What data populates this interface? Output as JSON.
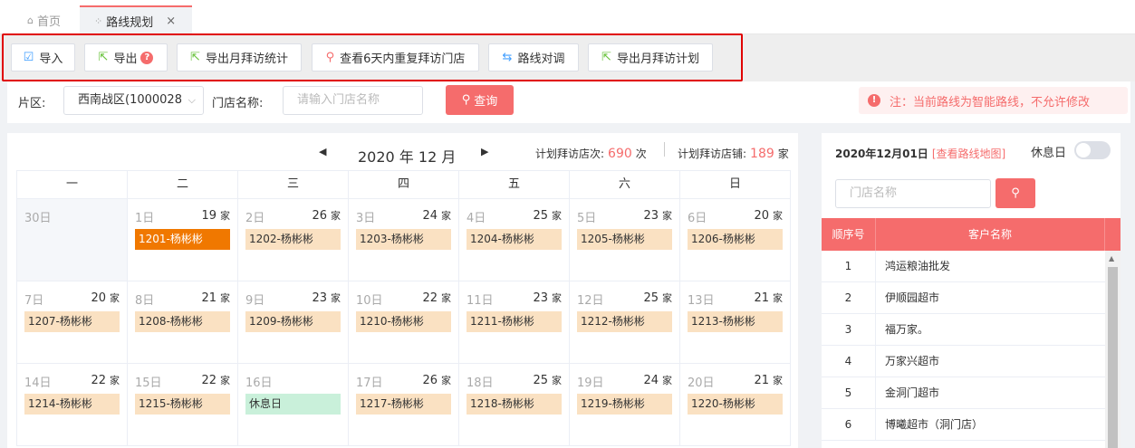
{
  "tabs": {
    "home": "首页",
    "active": "路线规划",
    "close": "×"
  },
  "toolbar": {
    "import": "导入",
    "export": "导出",
    "export_badge": "?",
    "export_month_stats": "导出月拜访统计",
    "check_repeat": "查看6天内重复拜访门店",
    "route_swap": "路线对调",
    "export_month_plan": "导出月拜访计划"
  },
  "filter": {
    "area_label": "片区:",
    "area_value": "西南战区(1000028",
    "store_label": "门店名称:",
    "store_placeholder": "请输入门店名称",
    "query": "查询",
    "notice": "注：当前路线为智能路线，不允许修改",
    "notice_icon": "!"
  },
  "calendar": {
    "month_title": "2020 年 12 月",
    "prev": "◀",
    "next": "▶",
    "plan_visits_label": "计划拜访店次:",
    "plan_visits_value": "690",
    "plan_visits_unit": "次",
    "plan_stores_label": "计划拜访店铺:",
    "plan_stores_value": "189",
    "plan_stores_unit": "家",
    "weekdays": [
      "一",
      "二",
      "三",
      "四",
      "五",
      "六",
      "日"
    ],
    "unit": "家",
    "weeks": [
      [
        {
          "day": "30日",
          "count": "",
          "route": "",
          "other": true
        },
        {
          "day": "1日",
          "count": "19",
          "route": "1201-杨彬彬",
          "selected": true
        },
        {
          "day": "2日",
          "count": "26",
          "route": "1202-杨彬彬"
        },
        {
          "day": "3日",
          "count": "24",
          "route": "1203-杨彬彬"
        },
        {
          "day": "4日",
          "count": "25",
          "route": "1204-杨彬彬"
        },
        {
          "day": "5日",
          "count": "23",
          "route": "1205-杨彬彬"
        },
        {
          "day": "6日",
          "count": "20",
          "route": "1206-杨彬彬"
        }
      ],
      [
        {
          "day": "7日",
          "count": "20",
          "route": "1207-杨彬彬"
        },
        {
          "day": "8日",
          "count": "21",
          "route": "1208-杨彬彬"
        },
        {
          "day": "9日",
          "count": "23",
          "route": "1209-杨彬彬"
        },
        {
          "day": "10日",
          "count": "22",
          "route": "1210-杨彬彬"
        },
        {
          "day": "11日",
          "count": "23",
          "route": "1211-杨彬彬"
        },
        {
          "day": "12日",
          "count": "25",
          "route": "1212-杨彬彬"
        },
        {
          "day": "13日",
          "count": "21",
          "route": "1213-杨彬彬"
        }
      ],
      [
        {
          "day": "14日",
          "count": "22",
          "route": "1214-杨彬彬"
        },
        {
          "day": "15日",
          "count": "22",
          "route": "1215-杨彬彬"
        },
        {
          "day": "16日",
          "count": "",
          "route": "休息日",
          "rest": true
        },
        {
          "day": "17日",
          "count": "26",
          "route": "1217-杨彬彬"
        },
        {
          "day": "18日",
          "count": "25",
          "route": "1218-杨彬彬"
        },
        {
          "day": "19日",
          "count": "24",
          "route": "1219-杨彬彬"
        },
        {
          "day": "20日",
          "count": "21",
          "route": "1220-杨彬彬"
        }
      ]
    ]
  },
  "right": {
    "date": "2020年12月01日",
    "map_link": "[查看路线地图]",
    "rest_label": "休息日",
    "store_placeholder": "门店名称",
    "col_seq": "顺序号",
    "col_name": "客户名称",
    "rows": [
      {
        "seq": "1",
        "name": "鸿运粮油批发"
      },
      {
        "seq": "2",
        "name": "伊顺园超市"
      },
      {
        "seq": "3",
        "name": "福万家。"
      },
      {
        "seq": "4",
        "name": "万家兴超市"
      },
      {
        "seq": "5",
        "name": "金洞门超市"
      },
      {
        "seq": "6",
        "name": "博曦超市（洞门店）"
      }
    ]
  },
  "colors": {
    "accent": "#f56c6c",
    "selected_route": "#f07800",
    "route": "#fae1c2",
    "rest_route": "#c9f0da",
    "highlight_box": "#e00000"
  }
}
